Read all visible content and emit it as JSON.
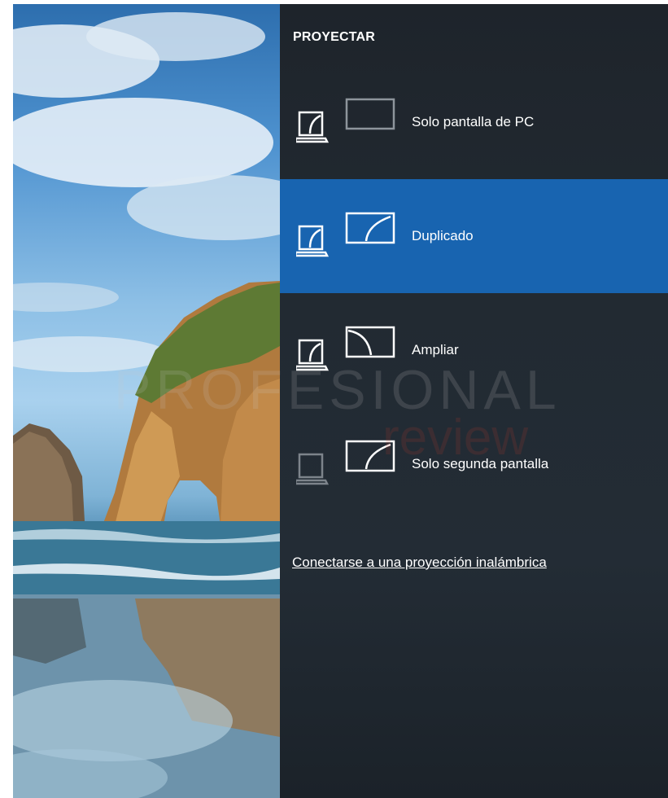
{
  "flyout": {
    "title": "PROYECTAR",
    "options": [
      {
        "label": "Solo pantalla de PC",
        "icon": "pc-screen-only-icon",
        "selected": false
      },
      {
        "label": "Duplicado",
        "icon": "duplicate-icon",
        "selected": true
      },
      {
        "label": "Ampliar",
        "icon": "extend-icon",
        "selected": false
      },
      {
        "label": "Solo segunda pantalla",
        "icon": "second-screen-only-icon",
        "selected": false
      }
    ],
    "wireless_link": "Conectarse a una proyección inalámbrica"
  },
  "watermark": {
    "line1": "PROFESIONAL",
    "line2": "review"
  },
  "colors": {
    "panel_bg": "#222a32",
    "selected_bg": "#1864b0",
    "text": "#ffffff"
  }
}
